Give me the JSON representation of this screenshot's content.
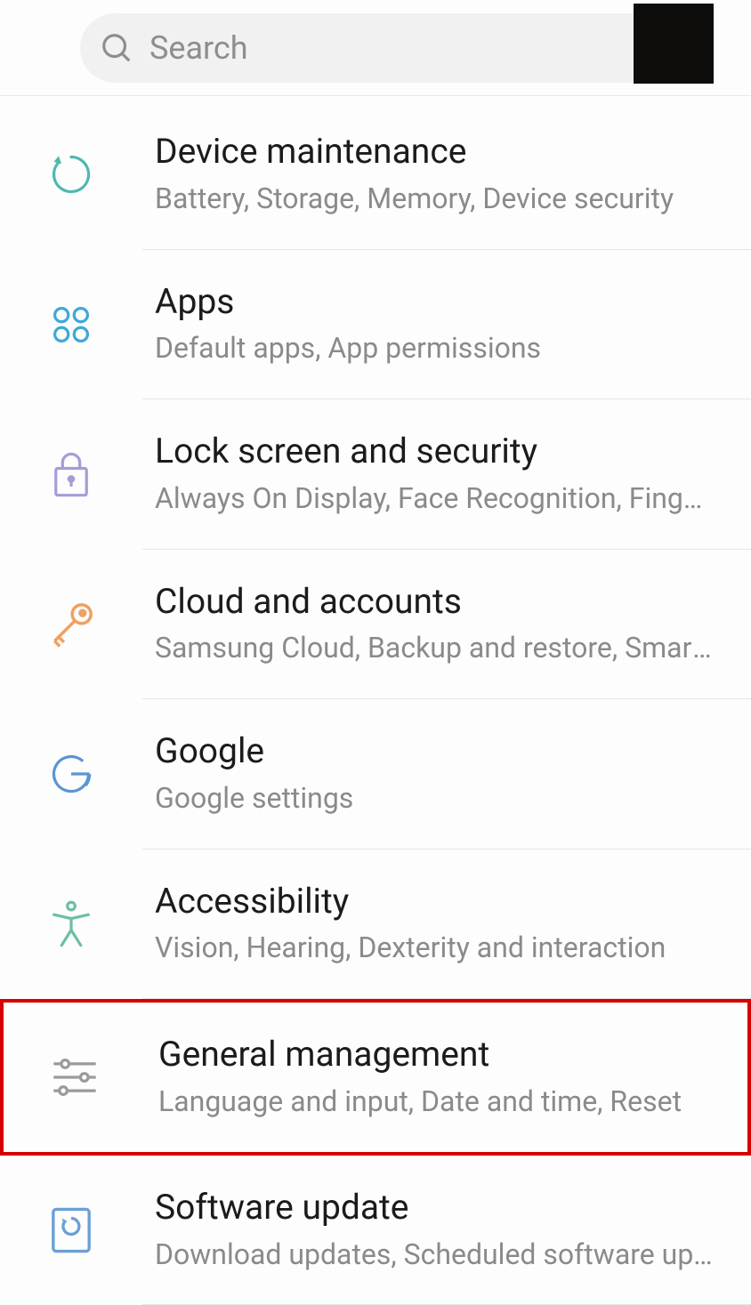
{
  "search": {
    "placeholder": "Search"
  },
  "items": [
    {
      "title": "Device maintenance",
      "subtitle": "Battery, Storage, Memory, Device security"
    },
    {
      "title": "Apps",
      "subtitle": "Default apps, App permissions"
    },
    {
      "title": "Lock screen and security",
      "subtitle": "Always On Display, Face Recognition, Fingerprint Scanner"
    },
    {
      "title": "Cloud and accounts",
      "subtitle": "Samsung Cloud, Backup and restore, Smart Switch"
    },
    {
      "title": "Google",
      "subtitle": "Google settings"
    },
    {
      "title": "Accessibility",
      "subtitle": "Vision, Hearing, Dexterity and interaction"
    },
    {
      "title": "General management",
      "subtitle": "Language and input, Date and time, Reset"
    },
    {
      "title": "Software update",
      "subtitle": "Download updates, Scheduled software updates"
    }
  ],
  "highlighted_index": 6
}
